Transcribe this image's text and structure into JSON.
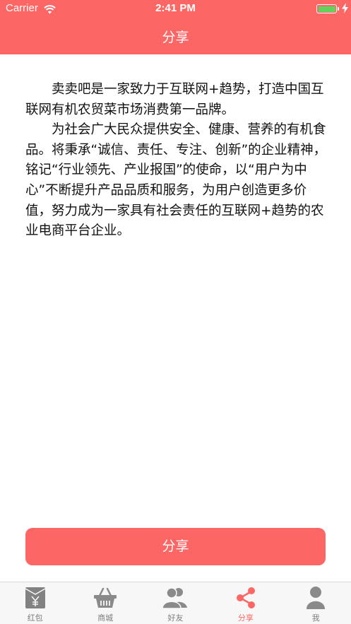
{
  "status_bar": {
    "carrier": "Carrier",
    "time": "2:41 PM"
  },
  "nav": {
    "title": "分享"
  },
  "content": {
    "paragraphs": [
      "卖卖吧是一家致力于互联网+趋势，打造中国互联网有机农贸菜市场消费第一品牌。",
      "为社会广大民众提供安全、健康、营养的有机食品。将秉承“诚信、责任、专注、创新”的企业精神，铭记“行业领先、产业报国”的使命，以“用户为中心”不断提升产品品质和服务，为用户创造更多价值，努力成为一家具有社会责任的互联网+趋势的农业电商平台企业。"
    ]
  },
  "share_button": {
    "label": "分享"
  },
  "tabbar": {
    "items": [
      {
        "label": "红包",
        "icon": "red-envelope-icon"
      },
      {
        "label": "商城",
        "icon": "basket-icon"
      },
      {
        "label": "好友",
        "icon": "friends-icon"
      },
      {
        "label": "分享",
        "icon": "share-icon",
        "active": true
      },
      {
        "label": "我",
        "icon": "user-icon"
      }
    ]
  },
  "colors": {
    "accent": "#fc6664",
    "tab_inactive": "#7d7d7d",
    "battery": "#5fd35a"
  }
}
